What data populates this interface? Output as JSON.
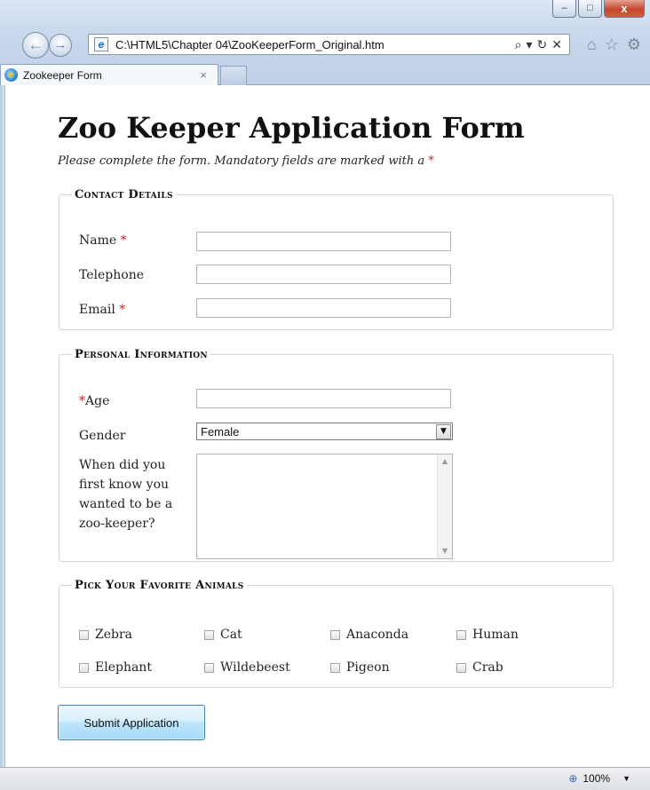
{
  "window": {
    "minimize_glyph": "–",
    "maximize_glyph": "□",
    "close_glyph": "x"
  },
  "nav": {
    "back_glyph": "←",
    "forward_glyph": "→"
  },
  "address": {
    "url": "C:\\HTML5\\Chapter 04\\ZooKeeperForm_Original.htm",
    "search_glyph": "⌕",
    "dropdown_glyph": "▾",
    "refresh_glyph": "↻",
    "stop_glyph": "✕"
  },
  "toolbar_icons": {
    "home": "⌂",
    "favorites": "☆",
    "settings": "⚙"
  },
  "tab": {
    "title": "Zookeeper Form",
    "close_glyph": "×",
    "icon_glyph": "e"
  },
  "page": {
    "title": "Zoo Keeper Application Form",
    "intro": "Please complete the form. Mandatory fields are marked with a",
    "required_marker": "*"
  },
  "contact": {
    "legend": "Contact Details",
    "fields": [
      {
        "label": "Name",
        "required": true,
        "value": ""
      },
      {
        "label": "Telephone",
        "required": false,
        "value": ""
      },
      {
        "label": "Email",
        "required": true,
        "value": ""
      }
    ]
  },
  "personal": {
    "legend": "Personal Information",
    "age_label": "Age",
    "age_value": "",
    "gender_label": "Gender",
    "gender_value": "Female",
    "question_label": "When did you first know you wanted to be a zoo-keeper?",
    "question_value": ""
  },
  "animals": {
    "legend": "Pick Your Favorite Animals",
    "items": [
      {
        "label": "Zebra",
        "checked": false
      },
      {
        "label": "Cat",
        "checked": false
      },
      {
        "label": "Anaconda",
        "checked": false
      },
      {
        "label": "Human",
        "checked": false
      },
      {
        "label": "Elephant",
        "checked": false
      },
      {
        "label": "Wildebeest",
        "checked": false
      },
      {
        "label": "Pigeon",
        "checked": false
      },
      {
        "label": "Crab",
        "checked": false
      }
    ]
  },
  "submit_label": "Submit Application",
  "status": {
    "zoom": "100%",
    "zoom_icon": "⊕",
    "zoom_menu_glyph": "▼"
  }
}
